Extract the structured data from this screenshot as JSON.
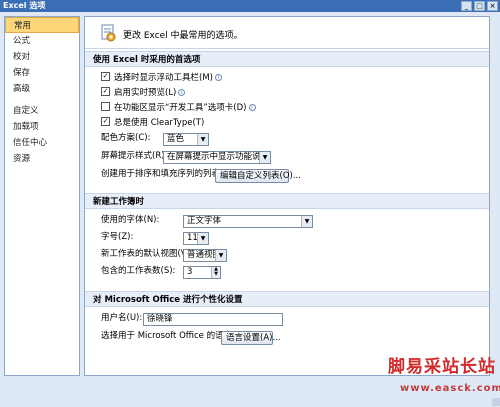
{
  "window": {
    "title": "Excel 选项",
    "min": "_",
    "max": "□",
    "close": "×"
  },
  "sidebar": {
    "items": [
      {
        "label": "常用"
      },
      {
        "label": "公式"
      },
      {
        "label": "校对"
      },
      {
        "label": "保存"
      },
      {
        "label": "高级"
      },
      {
        "label": "自定义"
      },
      {
        "label": "加载项"
      },
      {
        "label": "信任中心"
      },
      {
        "label": "资源"
      }
    ]
  },
  "header": {
    "text": "更改 Excel 中最常用的选项。"
  },
  "section1": {
    "title": "使用 Excel 时采用的首选项",
    "checks": [
      {
        "label": "选择时显示浮动工具栏(M)",
        "checked": "✓",
        "info": "i"
      },
      {
        "label": "启用实时预览(L)",
        "checked": "✓",
        "info": "i"
      },
      {
        "label": "在功能区显示“开发工具”选项卡(D)",
        "checked": "",
        "info": "i"
      },
      {
        "label": "总是使用 ClearType(T)",
        "checked": "✓",
        "info": ""
      }
    ],
    "color_scheme_label": "配色方案(C):",
    "color_scheme_value": "蓝色",
    "tooltip_style_label": "屏幕提示样式(R):",
    "tooltip_style_value": "在屏幕提示中显示功能说明",
    "custom_list_label": "创建用于排序和填充序列的列表:",
    "custom_list_button": "编辑自定义列表(O)..."
  },
  "section2": {
    "title": "新建工作簿时",
    "font_label": "使用的字体(N):",
    "font_value": "正文字体",
    "size_label": "字号(Z):",
    "size_value": "11",
    "view_label": "新工作表的默认视图(V):",
    "view_value": "普通视图",
    "sheets_label": "包含的工作表数(S):",
    "sheets_value": "3"
  },
  "section3": {
    "title": "对 Microsoft Office 进行个性化设置",
    "user_label": "用户名(U):",
    "user_value": "徐晓锋",
    "lang_label": "选择用于 Microsoft Office 的语言:",
    "lang_button": "语言设置(A)..."
  },
  "watermark": {
    "text": "脚易采站长站",
    "url": "www.easck.com"
  }
}
